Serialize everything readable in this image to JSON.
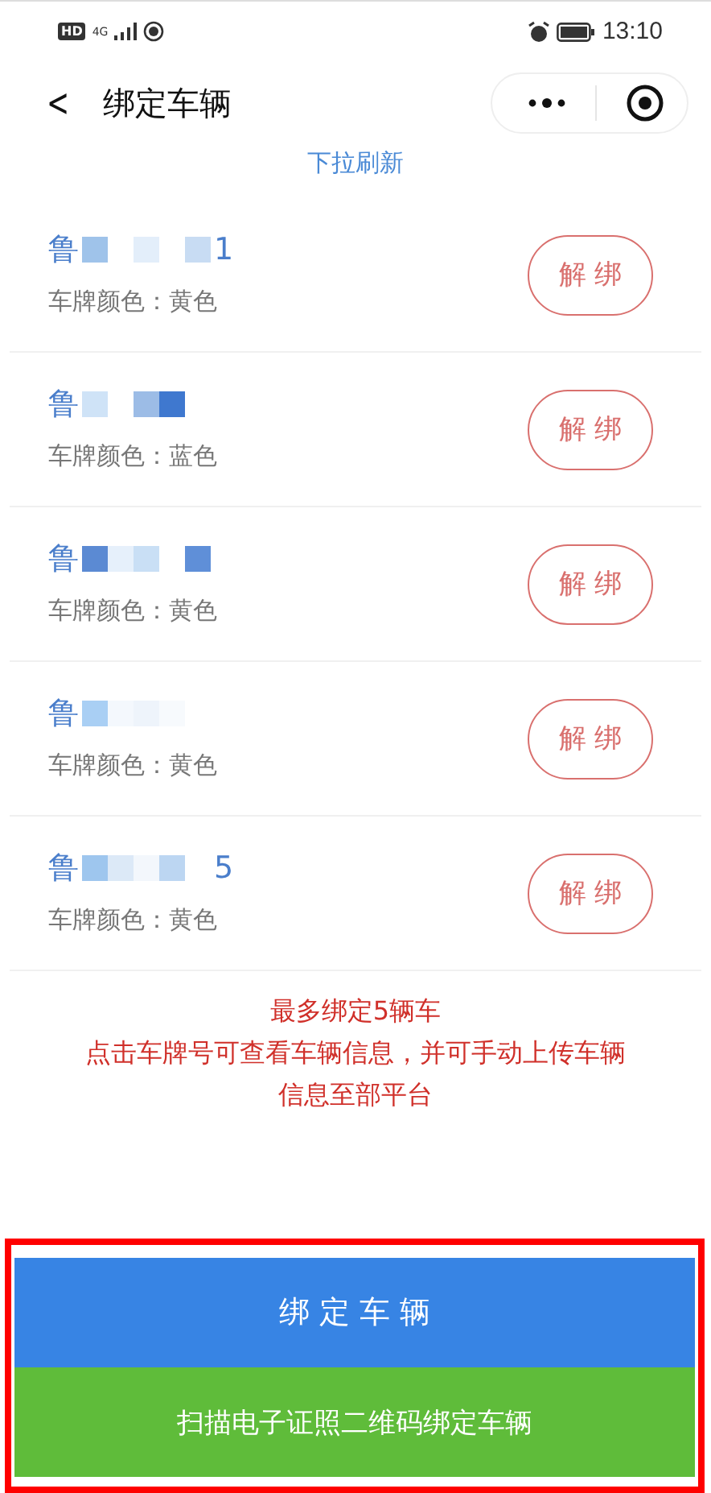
{
  "status_bar": {
    "hd": "HD",
    "network": "4G",
    "time": "13:10"
  },
  "nav": {
    "back": "<",
    "title": "绑定车辆"
  },
  "refresh_hint": "下拉刷新",
  "vehicles": [
    {
      "plate_prefix": "鲁",
      "plate_suffix": "1",
      "color_label": "车牌颜色：黄色",
      "unbind": "解 绑"
    },
    {
      "plate_prefix": "鲁",
      "color_label": "车牌颜色：蓝色",
      "unbind": "解 绑"
    },
    {
      "plate_prefix": "鲁",
      "color_label": "车牌颜色：黄色",
      "unbind": "解 绑"
    },
    {
      "plate_prefix": "鲁",
      "color_label": "车牌颜色：黄色",
      "unbind": "解 绑"
    },
    {
      "plate_prefix": "鲁",
      "plate_suffix": "5",
      "color_label": "车牌颜色：黄色",
      "unbind": "解 绑"
    }
  ],
  "notice": [
    "最多绑定5辆车",
    "点击车牌号可查看车辆信息，并可手动上传车辆信息至部平台"
  ],
  "buttons": [
    {
      "kind": "primary",
      "label": "绑 定 车 辆"
    },
    {
      "kind": "scan",
      "label": "扫描电子证照二维码绑定车辆"
    }
  ]
}
